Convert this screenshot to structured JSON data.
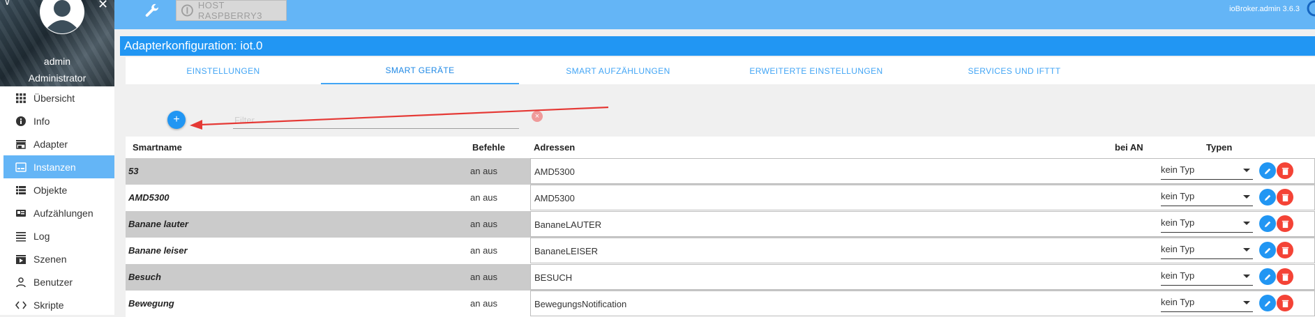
{
  "topbar": {
    "host_label": "HOST RASPBERRY3",
    "version": "ioBroker.admin 3.6.3",
    "color": "#64b5f6"
  },
  "sidebar": {
    "user_name": "admin",
    "user_role": "Administrator",
    "items": [
      {
        "label": "Übersicht",
        "icon": "grid-icon"
      },
      {
        "label": "Info",
        "icon": "info-icon"
      },
      {
        "label": "Adapter",
        "icon": "store-icon"
      },
      {
        "label": "Instanzen",
        "icon": "instances-icon",
        "active": true
      },
      {
        "label": "Objekte",
        "icon": "list-icon"
      },
      {
        "label": "Aufzählungen",
        "icon": "enum-icon"
      },
      {
        "label": "Log",
        "icon": "lines-icon"
      },
      {
        "label": "Szenen",
        "icon": "scenes-icon"
      },
      {
        "label": "Benutzer",
        "icon": "user-icon"
      },
      {
        "label": "Skripte",
        "icon": "code-icon"
      }
    ]
  },
  "panel": {
    "title": "Adapterkonfiguration: iot.0",
    "color": "#2196f3"
  },
  "tabs": [
    {
      "label": "EINSTELLUNGEN"
    },
    {
      "label": "SMART GERÄTE",
      "active": true
    },
    {
      "label": "SMART AUFZÄHLUNGEN"
    },
    {
      "label": "ERWEITERTE EINSTELLUNGEN"
    },
    {
      "label": "SERVICES UND IFTTT"
    }
  ],
  "toolbar": {
    "add_label": "+",
    "filter_placeholder": "Filter",
    "filter_value": "",
    "clear_label": "×"
  },
  "table": {
    "headers": {
      "smartname": "Smartname",
      "commands": "Befehle",
      "addresses": "Adressen",
      "on_value": "bei AN",
      "types": "Typen"
    },
    "rows": [
      {
        "smartname": "53",
        "commands": "an aus",
        "address": "AMD5300",
        "type": "kein Typ"
      },
      {
        "smartname": "AMD5300",
        "commands": "an aus",
        "address": "AMD5300",
        "type": "kein Typ"
      },
      {
        "smartname": "Banane lauter",
        "commands": "an aus",
        "address": "BananeLAUTER",
        "type": "kein Typ"
      },
      {
        "smartname": "Banane leiser",
        "commands": "an aus",
        "address": "BananeLEISER",
        "type": "kein Typ"
      },
      {
        "smartname": "Besuch",
        "commands": "an aus",
        "address": "BESUCH",
        "type": "kein Typ"
      },
      {
        "smartname": "Bewegung",
        "commands": "an aus",
        "address": "BewegungsNotification",
        "type": "kein Typ"
      }
    ]
  },
  "colors": {
    "delete": "#f44336",
    "edit": "#2196f3",
    "annotation_arrow": "#e53935"
  }
}
